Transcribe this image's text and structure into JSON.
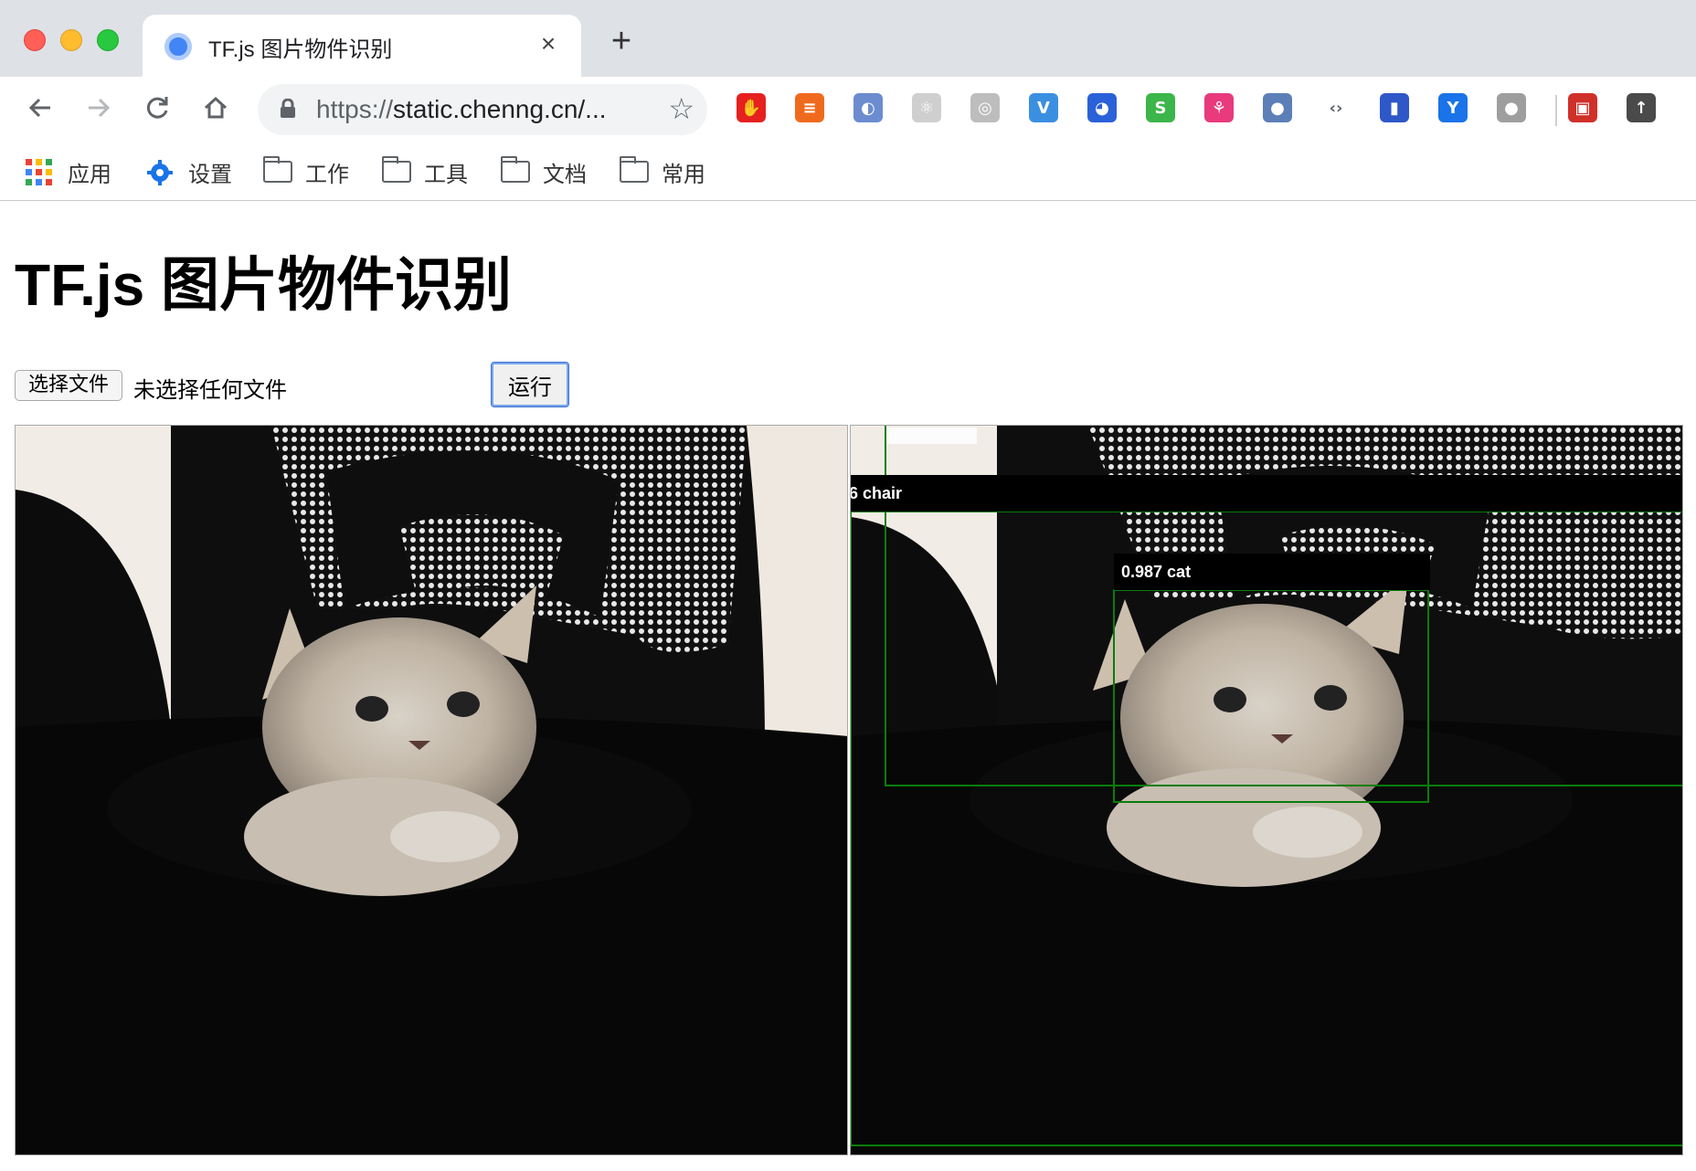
{
  "browser": {
    "tab": {
      "title": "TF.js 图片物件识别",
      "close_glyph": "×"
    },
    "new_tab_glyph": "+",
    "nav": {
      "back": "back-arrow-icon",
      "forward": "forward-arrow-icon",
      "reload": "reload-icon",
      "home": "home-icon"
    },
    "address": {
      "scheme": "https://",
      "rest": "static.chenng.cn/..."
    },
    "extensions": [
      {
        "name": "adblock-extension-icon",
        "color": "#e5201f",
        "glyph": "✋"
      },
      {
        "name": "stack-extension-icon",
        "color": "#f06a1d",
        "glyph": "≡"
      },
      {
        "name": "orbit-extension-icon",
        "color": "#6b8ccf",
        "glyph": "◐"
      },
      {
        "name": "react-devtools-icon",
        "color": "#cfcfcf",
        "glyph": "⚛"
      },
      {
        "name": "target-extension-icon",
        "color": "#bdbdbd",
        "glyph": "◎"
      },
      {
        "name": "vimium-extension-icon",
        "color": "#3b8fe0",
        "glyph": "V"
      },
      {
        "name": "octotree-extension-icon",
        "color": "#2b61d8",
        "glyph": "◕"
      },
      {
        "name": "s-extension-icon",
        "color": "#3cb54a",
        "glyph": "S"
      },
      {
        "name": "pink-extension-icon",
        "color": "#e83a7d",
        "glyph": "⚘"
      },
      {
        "name": "globe-extension-icon",
        "color": "#5c7fb8",
        "glyph": "●"
      },
      {
        "name": "code-extension-icon",
        "color": "#ffffff",
        "glyph": "‹›"
      },
      {
        "name": "lighthouse-extension-icon",
        "color": "#2e57c8",
        "glyph": "▮"
      },
      {
        "name": "y-extension-icon",
        "color": "#1a73e8",
        "glyph": "Y"
      },
      {
        "name": "green-dot-extension-icon",
        "color": "#9e9e9e",
        "glyph": "●"
      },
      {
        "name": "screen-extension-icon",
        "color": "#d0302a",
        "glyph": "▣"
      },
      {
        "name": "upload-extension-icon",
        "color": "#4a4a4a",
        "glyph": "↑"
      }
    ],
    "bookmarks": {
      "apps": "应用",
      "settings": "设置",
      "folders": [
        "工作",
        "工具",
        "文档",
        "常用"
      ]
    }
  },
  "page": {
    "title": "TF.js 图片物件识别",
    "file_input": {
      "button_label": "选择文件",
      "status": "未选择任何文件"
    },
    "run_button": "运行",
    "detections": [
      {
        "label": "6 chair"
      },
      {
        "label": "0.987 cat"
      }
    ]
  }
}
